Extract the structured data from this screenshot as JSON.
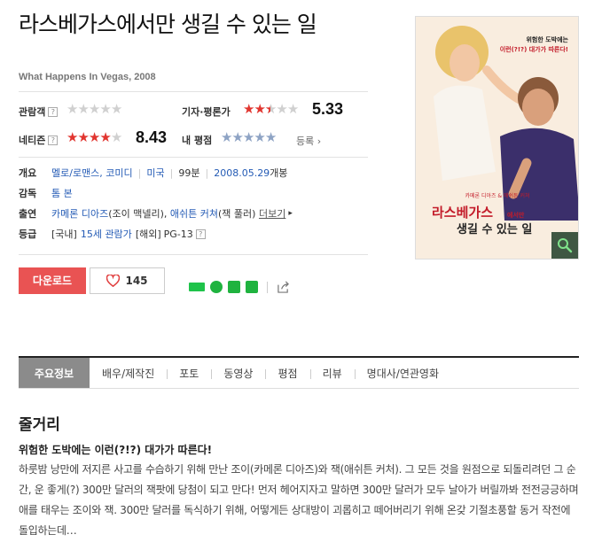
{
  "movie": {
    "title": "라스베가스에서만 생길 수 있는 일",
    "original_title": "What Happens In Vegas, 2008"
  },
  "ratings": {
    "audience": {
      "label": "관람객",
      "stars": 0,
      "score": ""
    },
    "critics": {
      "label": "기자·평론가",
      "stars": 2.5,
      "score": "5.33"
    },
    "netizen": {
      "label": "네티즌",
      "stars": 4,
      "score": "8.43"
    },
    "mine": {
      "label": "내 평점",
      "stars": 0,
      "link": "등록"
    }
  },
  "info": {
    "overview_label": "개요",
    "genre": "멜로/로맨스, 코미디",
    "country": "미국",
    "runtime": "99분",
    "release": "2008.05.29",
    "release_suffix": "개봉",
    "director_label": "감독",
    "director": "톰 본",
    "cast_label": "출연",
    "cast_1": "카메론 디아즈",
    "cast_1_role": "(조이 맥넬리)",
    "cast_2": "애쉬튼 커쳐",
    "cast_2_role": "(잭 풀러)",
    "more": "더보기",
    "grade_label": "등급",
    "grade_kr_prefix": "[국내]",
    "grade_kr": "15세 관람가",
    "grade_intl_prefix": "[해외]",
    "grade_intl": "PG-13"
  },
  "actions": {
    "download": "다운로드",
    "like_count": "145"
  },
  "poster": {
    "tagline_1": "위험한 도박에는",
    "tagline_2": "이런(?!?) 대가가 따른다!",
    "actors": "카메론 디아즈 & 애쉬튼 커쳐",
    "title_line1": "라스베가스",
    "title_line2": "에서만",
    "title_line3": "생길 수 있는 일"
  },
  "tabs": [
    "주요정보",
    "배우/제작진",
    "포토",
    "동영상",
    "평점",
    "리뷰",
    "명대사/연관영화"
  ],
  "synopsis": {
    "section_title": "줄거리",
    "headline": "위험한 도박에는 이런(?!?) 대가가 따른다!",
    "body": "하룻밤 낭만에 저지른 사고를 수습하기 위해 만난 조이(카메론 디아즈)와 잭(애쉬튼 커처). 그 모든 것을 원점으로 되돌리려던 그 순간, 운 좋게(?) 300만 달러의 잭팟에 당첨이 되고 만다! 먼저 헤어지자고 말하면 300만 달러가 모두 날아가 버릴까봐 전전긍긍하며 애를 태우는 조이와 잭. 300만 달러를 독식하기 위해, 어떻게든 상대방이 괴롭히고 떼어버리기 위해 온갖 기절초풍할 동거 작전에 돌입하는데…"
  },
  "colors": {
    "star_on": "#e1352f",
    "star_off": "#d0d0d0",
    "star_mine": "#8ea3c4",
    "accent": "#e95353",
    "link": "#245bb5"
  }
}
